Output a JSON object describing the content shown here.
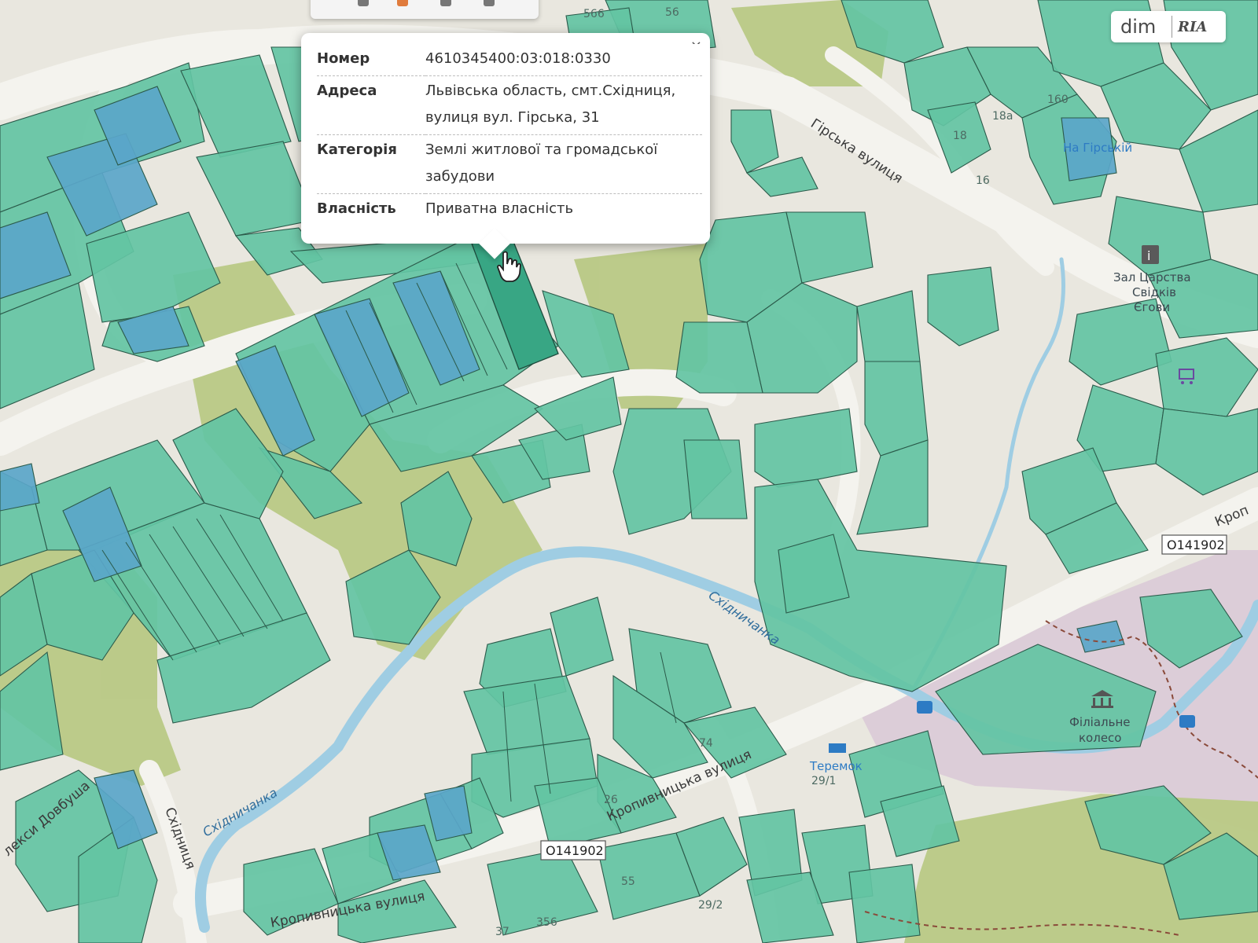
{
  "popup": {
    "close_label": "×",
    "rows": [
      {
        "key": "Номер",
        "value_lines": [
          "4610345400:03:018:0330"
        ]
      },
      {
        "key": "Адреса",
        "value_lines": [
          "Львівська область, смт.Східниця,",
          "вулиця вул. Гірська, 31"
        ]
      },
      {
        "key": "Категорія",
        "value_lines": [
          "Землі житлової та громадської",
          "забудови"
        ]
      },
      {
        "key": "Власність",
        "value_lines": [
          "Приватна власність"
        ]
      }
    ]
  },
  "watermark": {
    "left": "dim",
    "right": "RIA"
  },
  "map": {
    "roads": {
      "girska": "Гірська вулиця",
      "kropyvnytska_1": "Кропивницька вулиця",
      "kropyvnytska_2": "Кропивницька вулиця",
      "kropyvnytska_edge": "Кроп",
      "dovbusha": "лекси Довбуша",
      "skhidnytsia": "Східниця"
    },
    "water": {
      "river_1": "Східничанка",
      "river_2": "Східничанка"
    },
    "refs": {
      "ref_1": "O141902",
      "ref_2": "O141902"
    },
    "pois": {
      "hall_line1": "Зал Царства",
      "hall_line2": "Свідків",
      "hall_line3": "Єгови",
      "na_girskii": "На Гірській",
      "teremok": "Теремок",
      "filialne_line1": "Філіальне",
      "filialne_line2": "колесо"
    },
    "house_numbers": [
      "566",
      "56",
      "160",
      "18а",
      "18",
      "16",
      "74",
      "26",
      "29/1",
      "29/2",
      "37",
      "356",
      "55"
    ]
  },
  "colors": {
    "parcel_green": "#63c4a3",
    "parcel_blue": "#5aa6c9",
    "forest": "#b7c97f",
    "road": "#f3f2ec",
    "water": "#9fcde3",
    "pink_zone": "#dccdd8"
  }
}
